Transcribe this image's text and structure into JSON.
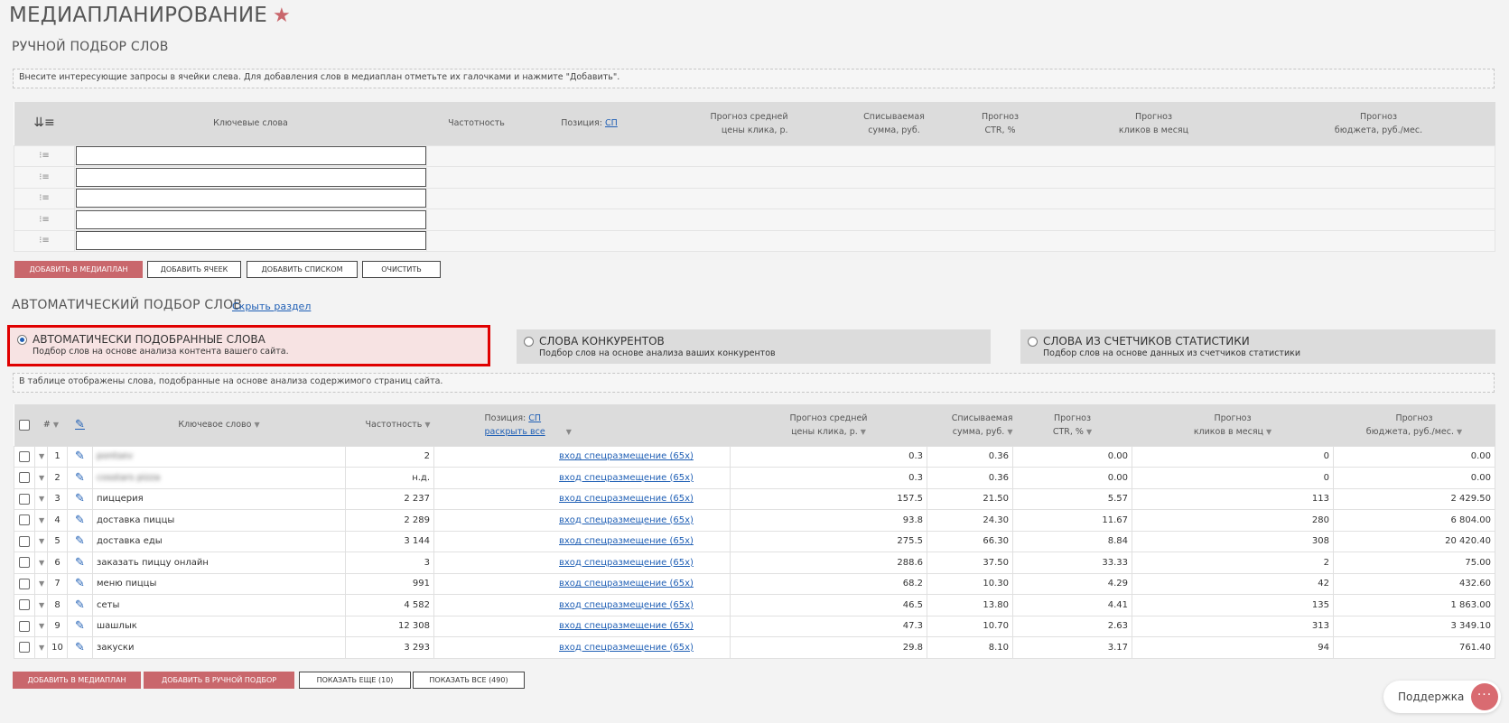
{
  "page": {
    "title": "МЕДИАПЛАНИРОВАНИЕ",
    "star_icon": "star-icon"
  },
  "manual": {
    "section_title": "РУЧНОЙ ПОДБОР СЛОВ",
    "hint": "Внесите интересующие запросы в ячейки слева. Для добавления слов в медиаплан отметьте их галочками и нажмите \"Добавить\".",
    "headers": {
      "keywords": "Ключевые слова",
      "frequency": "Частотность",
      "position_label": "Позиция:",
      "position_value": "СП",
      "cpc_1": "Прогноз средней",
      "cpc_2": "цены клика, р.",
      "charge_1": "Списываемая",
      "charge_2": "сумма, руб.",
      "ctr_1": "Прогноз",
      "ctr_2": "CTR, %",
      "clicks_1": "Прогноз",
      "clicks_2": "кликов в месяц",
      "budget_1": "Прогноз",
      "budget_2": "бюджета, руб./мес."
    },
    "buttons": {
      "add_to_mediaplan": "ДОБАВИТЬ В МЕДИАПЛАН",
      "add_cells": "ДОБАВИТЬ ЯЧЕЕК",
      "add_list": "ДОБАВИТЬ СПИСКОМ",
      "clear": "ОЧИСТИТЬ"
    }
  },
  "auto": {
    "section_title": "АВТОМАТИЧЕСКИЙ ПОДБОР СЛОВ",
    "hide_link": "Скрыть раздел",
    "panels": [
      {
        "title": "АВТОМАТИЧЕСКИ ПОДОБРАННЫЕ СЛОВА",
        "subtitle": "Подбор слов на основе анализа контента вашего сайта.",
        "selected": true
      },
      {
        "title": "СЛОВА КОНКУРЕНТОВ",
        "subtitle": "Подбор слов на основе анализа ваших конкурентов",
        "selected": false
      },
      {
        "title": "СЛОВА ИЗ СЧЕТЧИКОВ СТАТИСТИКИ",
        "subtitle": "Подбор слов на основе данных из счетчиков статистики",
        "selected": false
      }
    ],
    "hint": "В таблице отображены слова, подобранные на основе анализа содержимого страниц сайта.",
    "headers": {
      "num": "#",
      "keyword": "Ключевое слово",
      "frequency": "Частотность",
      "position_label": "Позиция:",
      "position_value": "СП",
      "expand_all": "раскрыть все",
      "cpc_1": "Прогноз средней",
      "cpc_2": "цены клика, р.",
      "charge_1": "Списываемая",
      "charge_2": "сумма, руб.",
      "ctr_1": "Прогноз",
      "ctr_2": "CTR, %",
      "clicks_1": "Прогноз",
      "clicks_2": "кликов в месяц",
      "budget_1": "Прогноз",
      "budget_2": "бюджета, руб./мес."
    },
    "rows": [
      {
        "n": "1",
        "keyword": "pontsev",
        "blurred": true,
        "freq": "2",
        "pos": "вход спецразмещение (65x)",
        "cpc": "0.3",
        "charge": "0.36",
        "ctr": "0.00",
        "clicks": "0",
        "budget": "0.00"
      },
      {
        "n": "2",
        "keyword": "cosstars pizza",
        "blurred": true,
        "freq": "н.д.",
        "pos": "вход спецразмещение (65x)",
        "cpc": "0.3",
        "charge": "0.36",
        "ctr": "0.00",
        "clicks": "0",
        "budget": "0.00"
      },
      {
        "n": "3",
        "keyword": "пиццерия",
        "freq": "2 237",
        "pos": "вход спецразмещение (65x)",
        "cpc": "157.5",
        "charge": "21.50",
        "ctr": "5.57",
        "clicks": "113",
        "budget": "2 429.50"
      },
      {
        "n": "4",
        "keyword": "доставка пиццы",
        "freq": "2 289",
        "pos": "вход спецразмещение (65x)",
        "cpc": "93.8",
        "charge": "24.30",
        "ctr": "11.67",
        "clicks": "280",
        "budget": "6 804.00"
      },
      {
        "n": "5",
        "keyword": "доставка еды",
        "freq": "3 144",
        "pos": "вход спецразмещение (65x)",
        "cpc": "275.5",
        "charge": "66.30",
        "ctr": "8.84",
        "clicks": "308",
        "budget": "20 420.40"
      },
      {
        "n": "6",
        "keyword": "заказать пиццу онлайн",
        "freq": "3",
        "pos": "вход спецразмещение (65x)",
        "cpc": "288.6",
        "charge": "37.50",
        "ctr": "33.33",
        "clicks": "2",
        "budget": "75.00"
      },
      {
        "n": "7",
        "keyword": "меню пиццы",
        "freq": "991",
        "pos": "вход спецразмещение (65x)",
        "cpc": "68.2",
        "charge": "10.30",
        "ctr": "4.29",
        "clicks": "42",
        "budget": "432.60"
      },
      {
        "n": "8",
        "keyword": "сеты",
        "freq": "4 582",
        "pos": "вход спецразмещение (65x)",
        "cpc": "46.5",
        "charge": "13.80",
        "ctr": "4.41",
        "clicks": "135",
        "budget": "1 863.00"
      },
      {
        "n": "9",
        "keyword": "шашлык",
        "freq": "12 308",
        "pos": "вход спецразмещение (65x)",
        "cpc": "47.3",
        "charge": "10.70",
        "ctr": "2.63",
        "clicks": "313",
        "budget": "3 349.10"
      },
      {
        "n": "10",
        "keyword": "закуски",
        "freq": "3 293",
        "pos": "вход спецразмещение (65x)",
        "cpc": "29.8",
        "charge": "8.10",
        "ctr": "3.17",
        "clicks": "94",
        "budget": "761.40"
      }
    ],
    "buttons": {
      "add_to_mediaplan": "ДОБАВИТЬ В МЕДИАПЛАН",
      "add_to_manual": "ДОБАВИТЬ В РУЧНОЙ ПОДБОР",
      "show_more": "ПОКАЗАТЬ ЕЩЕ (10)",
      "show_all": "ПОКАЗАТЬ ВСЕ (490)"
    }
  },
  "support": {
    "label": "Поддержка"
  },
  "colors": {
    "accent": "#c9676c",
    "link": "#1f5fb5",
    "highlight_border": "#e00000"
  }
}
